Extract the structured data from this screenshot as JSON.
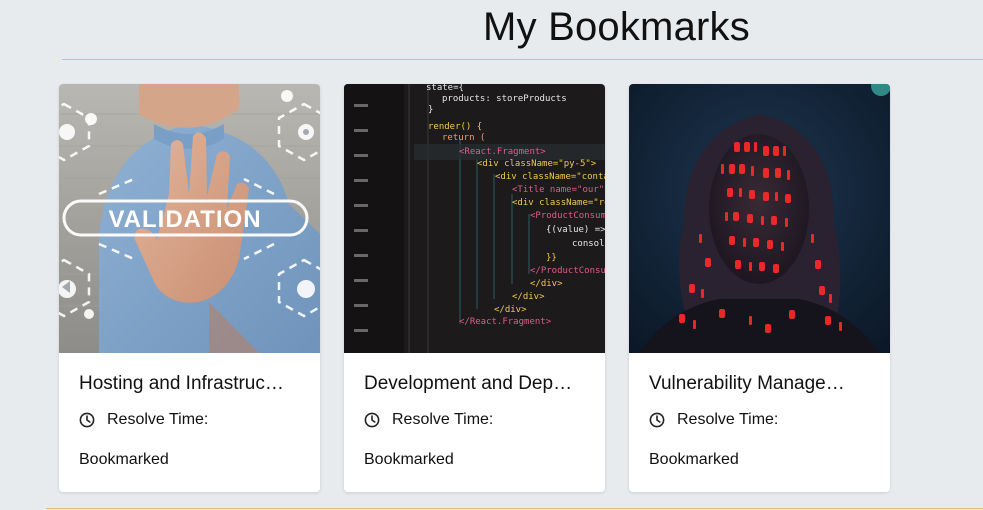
{
  "page": {
    "title": "My Bookmarks"
  },
  "cards": [
    {
      "title": "Hosting and Infrastruc…",
      "resolve_label": "Resolve Time:",
      "status": "Bookmarked",
      "image_text": "VALIDATION",
      "image_icon": "validation-hand-image"
    },
    {
      "title": "Development and Dep…",
      "resolve_label": "Resolve Time:",
      "status": "Bookmarked",
      "image_icon": "code-screen-image",
      "code_lines": [
        "state={",
        "products: storeProducts",
        "}",
        "render() {",
        "return (",
        "<React.Fragment>",
        "<div className=\"py-5\">",
        "<div className=\"contain",
        "<Title name=\"our\" t",
        "<div className=\"row\"",
        "<ProductConsumer",
        "{(value) =>",
        "console",
        "}}",
        "</ProductConsume",
        "</div>",
        "</div>",
        "</div>",
        "</React.Fragment>"
      ]
    },
    {
      "title": "Vulnerability Manage…",
      "resolve_label": "Resolve Time:",
      "status": "Bookmarked",
      "image_icon": "binary-projection-portrait-image"
    }
  ],
  "colors": {
    "background": "#e8ebee",
    "rule": "#d9c36b",
    "card": "#ffffff"
  }
}
